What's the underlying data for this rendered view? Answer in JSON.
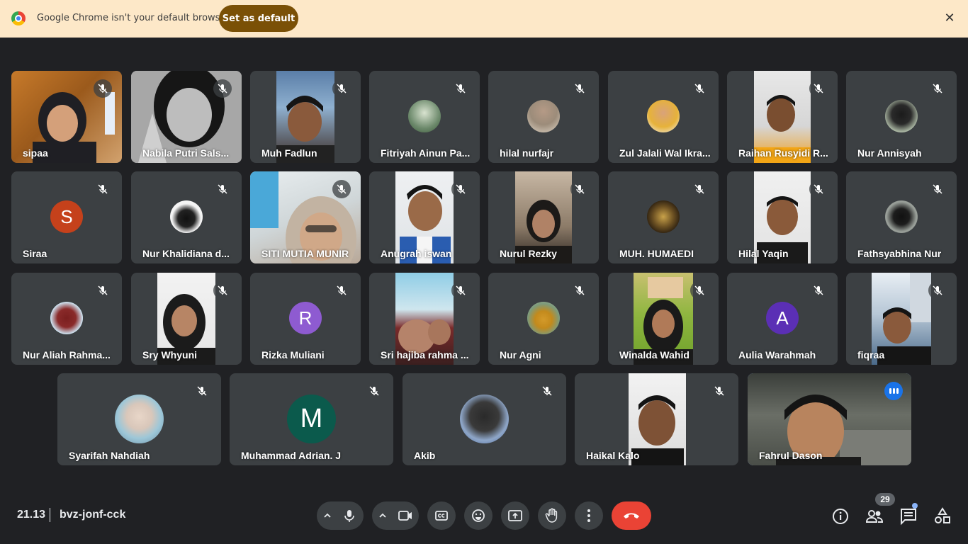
{
  "infobar": {
    "message": "Google Chrome isn't your default browser",
    "set_default_label": "Set as default",
    "close_glyph": "✕"
  },
  "participants": [
    {
      "name": "sipaa"
    },
    {
      "name": "Nabila Putri Sals..."
    },
    {
      "name": "Muh Fadlun"
    },
    {
      "name": "Fitriyah Ainun Pa..."
    },
    {
      "name": "hilal nurfajr"
    },
    {
      "name": "Zul Jalali Wal Ikra..."
    },
    {
      "name": "Raihan Rusyidi R..."
    },
    {
      "name": "Nur Annisyah"
    },
    {
      "name": "Siraa",
      "initial": "S",
      "avatar_color": "#c5411b"
    },
    {
      "name": "Nur Khalidiana d..."
    },
    {
      "name": "SITI MUTIA MUNIR"
    },
    {
      "name": "Anugrah iswan"
    },
    {
      "name": "Nurul Rezky"
    },
    {
      "name": "MUH. HUMAEDI"
    },
    {
      "name": "Hilal Yaqin"
    },
    {
      "name": "Fathsyabhina Nur"
    },
    {
      "name": "Nur Aliah Rahma..."
    },
    {
      "name": "Sry Whyuni"
    },
    {
      "name": "Rizka Muliani",
      "initial": "R",
      "avatar_color": "#8e5bd1"
    },
    {
      "name": "Sri hajiba rahma ..."
    },
    {
      "name": "Nur Agni"
    },
    {
      "name": "Winalda Wahid"
    },
    {
      "name": "Aulia Warahmah",
      "initial": "A",
      "avatar_color": "#5b2fb5"
    },
    {
      "name": "fiqraa"
    },
    {
      "name": "Syarifah Nahdiah"
    },
    {
      "name": "Muhammad Adrian. J",
      "initial": "M",
      "avatar_color": "#0b5a4c"
    },
    {
      "name": "Akib"
    },
    {
      "name": "Haikal Kalo"
    },
    {
      "name": "Fahrul Dason"
    }
  ],
  "bottom_bar": {
    "time": "21.13",
    "separator": "|",
    "meeting_code": "bvz-jonf-cck",
    "participant_count": "29"
  },
  "colors": {
    "background": "#202124",
    "tile": "#3c4043",
    "infobar": "#fde8c8",
    "set_default_button": "#7a5006",
    "end_call": "#ea4335",
    "speaking_outline": "#8ab4f8"
  }
}
